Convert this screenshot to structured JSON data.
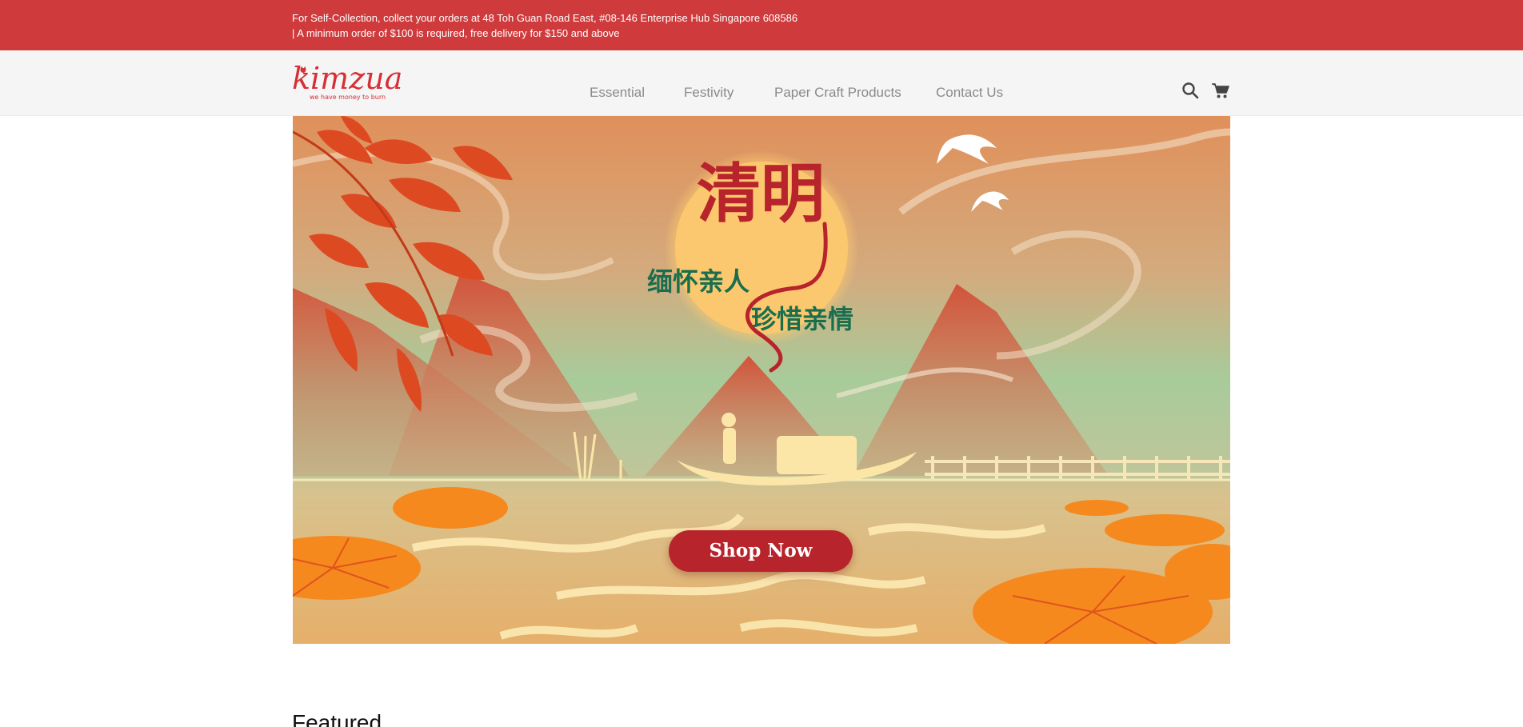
{
  "announcement": {
    "line1": "For Self-Collection, collect your orders at 48 Toh Guan Road East, #08-146 Enterprise Hub Singapore 608586",
    "line2": "| A minimum order of $100 is required, free delivery for $150 and above"
  },
  "brand": {
    "name": "kimzua",
    "tagline": "we have money to burn",
    "color": "#d62f35"
  },
  "nav": {
    "items": [
      {
        "label": "Essential"
      },
      {
        "label": "Festivity"
      },
      {
        "label": "Paper Craft Products"
      },
      {
        "label": "Contact Us"
      }
    ]
  },
  "header_icons": [
    "search-icon",
    "cart-icon"
  ],
  "hero": {
    "title_cn": "清明",
    "line1_cn": "缅怀亲人",
    "line2_cn": "珍惜亲情",
    "cta_label": "Shop Now",
    "cta_color": "#b8242b"
  },
  "colors": {
    "topbar": "#cf3b3d",
    "header_bg": "#f5f5f5",
    "nav_text": "#8a8a8a"
  },
  "section": {
    "featured_title": "Featured"
  }
}
